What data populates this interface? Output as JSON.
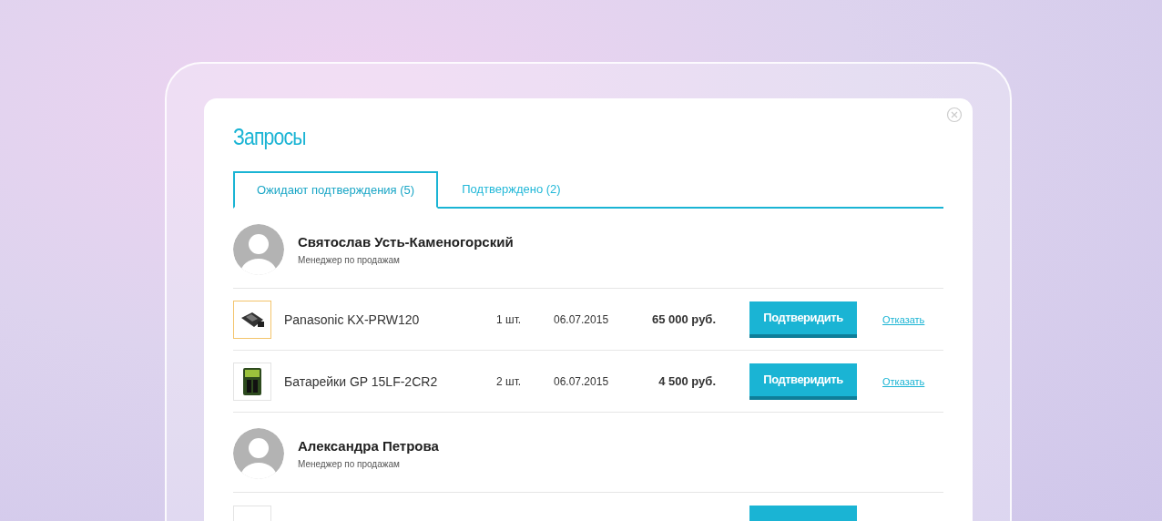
{
  "title": "Запросы",
  "tabs": [
    {
      "label": "Ожидают подтверждения (5)",
      "selected": true
    },
    {
      "label": "Подтверждено (2)",
      "selected": false
    }
  ],
  "groups": [
    {
      "name": "Святослав Усть-Каменогорский",
      "role": "Менеджер по продажам",
      "items": [
        {
          "product": "Panasonic KX-PRW120",
          "kind": "phone",
          "highlighted": true,
          "qty": "1 шт.",
          "date": "06.07.2015",
          "price": "65 000 руб.",
          "confirm": "Подтверидить",
          "reject": "Отказать"
        },
        {
          "product": "Батарейки GP 15LF-2CR2",
          "kind": "battery",
          "highlighted": false,
          "qty": "2 шт.",
          "date": "06.07.2015",
          "price": "4 500 руб.",
          "confirm": "Подтверидить",
          "reject": "Отказать"
        }
      ]
    },
    {
      "name": "Александра Петрова",
      "role": "Менеджер по продажам",
      "partial_row": true
    }
  ]
}
